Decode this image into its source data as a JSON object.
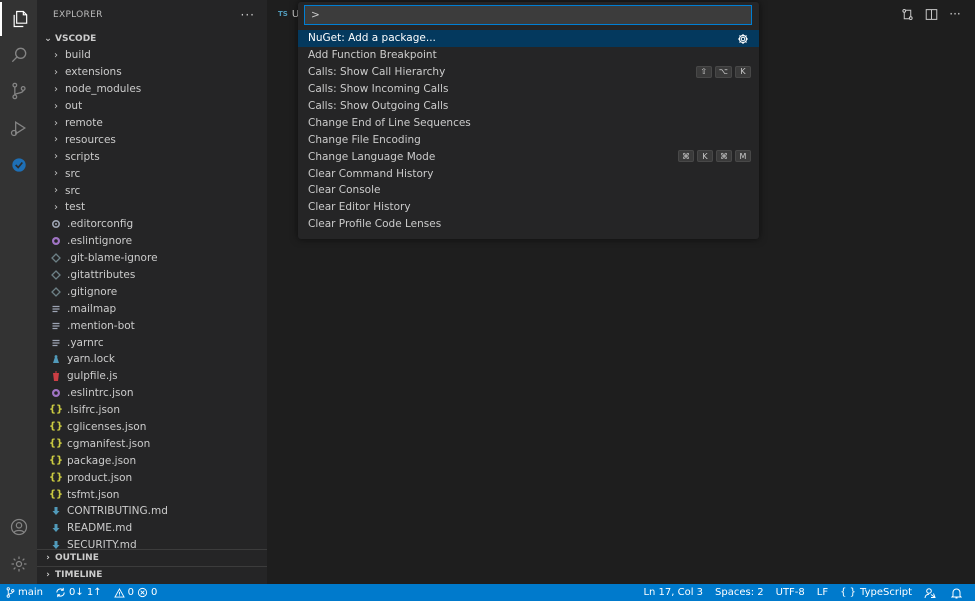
{
  "sidebar": {
    "title": "EXPLORER",
    "more": "···",
    "root_label": "VSCODE",
    "items": [
      {
        "label": "build",
        "kind": "folder"
      },
      {
        "label": "extensions",
        "kind": "folder"
      },
      {
        "label": "node_modules",
        "kind": "folder"
      },
      {
        "label": "out",
        "kind": "folder"
      },
      {
        "label": "remote",
        "kind": "folder"
      },
      {
        "label": "resources",
        "kind": "folder"
      },
      {
        "label": "scripts",
        "kind": "folder"
      },
      {
        "label": "src",
        "kind": "folder"
      },
      {
        "label": "src",
        "kind": "folder"
      },
      {
        "label": "test",
        "kind": "folder"
      },
      {
        "label": ".editorconfig",
        "kind": "gear-file-icon",
        "color": "#9da5b4"
      },
      {
        "label": ".eslintignore",
        "kind": "eslint-file-icon",
        "color": "#a074c4"
      },
      {
        "label": ".git-blame-ignore",
        "kind": "diamond-file-icon",
        "color": "#6d8086"
      },
      {
        "label": ".gitattributes",
        "kind": "diamond-file-icon",
        "color": "#6d8086"
      },
      {
        "label": ".gitignore",
        "kind": "diamond-file-icon",
        "color": "#6d8086"
      },
      {
        "label": ".mailmap",
        "kind": "lines-file-icon",
        "color": "#9da5b4"
      },
      {
        "label": ".mention-bot",
        "kind": "lines-file-icon",
        "color": "#9da5b4"
      },
      {
        "label": ".yarnrc",
        "kind": "lines-file-icon",
        "color": "#9da5b4"
      },
      {
        "label": "yarn.lock",
        "kind": "yarn-file-icon",
        "color": "#519aba"
      },
      {
        "label": "gulpfile.js",
        "kind": "gulp-file-icon",
        "color": "#cc3e44"
      },
      {
        "label": ".eslintrc.json",
        "kind": "eslint-file-icon",
        "color": "#a074c4"
      },
      {
        "label": ".lsifrc.json",
        "kind": "json-file-icon",
        "color": "#cbcb41"
      },
      {
        "label": "cglicenses.json",
        "kind": "json-file-icon",
        "color": "#cbcb41"
      },
      {
        "label": "cgmanifest.json",
        "kind": "json-file-icon",
        "color": "#cbcb41"
      },
      {
        "label": "package.json",
        "kind": "json-file-icon",
        "color": "#cbcb41"
      },
      {
        "label": "product.json",
        "kind": "json-file-icon",
        "color": "#cbcb41"
      },
      {
        "label": "tsfmt.json",
        "kind": "json-file-icon",
        "color": "#cbcb41"
      },
      {
        "label": "CONTRIBUTING.md",
        "kind": "markdown-file-icon",
        "color": "#519aba"
      },
      {
        "label": "README.md",
        "kind": "markdown-file-icon",
        "color": "#519aba"
      },
      {
        "label": "SECURITY.md",
        "kind": "markdown-file-icon",
        "color": "#519aba"
      }
    ],
    "outline_label": "OUTLINE",
    "timeline_label": "TIMELINE"
  },
  "editor": {
    "tab_lang": "TS",
    "tab_name": "U"
  },
  "palette": {
    "input_value": ">",
    "commands": [
      {
        "label": "NuGet: Add a package...",
        "selected": true,
        "gear": true,
        "keys": []
      },
      {
        "label": "Add Function Breakpoint",
        "keys": []
      },
      {
        "label": "Calls: Show Call Hierarchy",
        "keys": [
          "⇧",
          "⌥",
          "K"
        ]
      },
      {
        "label": "Calls: Show Incoming Calls",
        "keys": []
      },
      {
        "label": "Calls: Show Outgoing Calls",
        "keys": []
      },
      {
        "label": "Change End of Line Sequences",
        "keys": []
      },
      {
        "label": "Change File Encoding",
        "keys": []
      },
      {
        "label": "Change Language Mode",
        "keys": [
          "⌘",
          "K",
          "⌘",
          "M"
        ]
      },
      {
        "label": "Clear Command History",
        "keys": []
      },
      {
        "label": "Clear Console",
        "keys": []
      },
      {
        "label": "Clear Editor History",
        "keys": []
      },
      {
        "label": "Clear Profile Code Lenses",
        "keys": []
      }
    ]
  },
  "statusbar": {
    "branch": "main",
    "sync": "0↓ 1↑",
    "warnings": "0",
    "errors": "0",
    "position": "Ln 17, Col 3",
    "spaces": "Spaces: 2",
    "encoding": "UTF-8",
    "eol": "LF",
    "language": "TypeScript"
  },
  "colors": {
    "accent": "#007acc",
    "selection": "#04395e",
    "input_border": "#007fd4"
  }
}
